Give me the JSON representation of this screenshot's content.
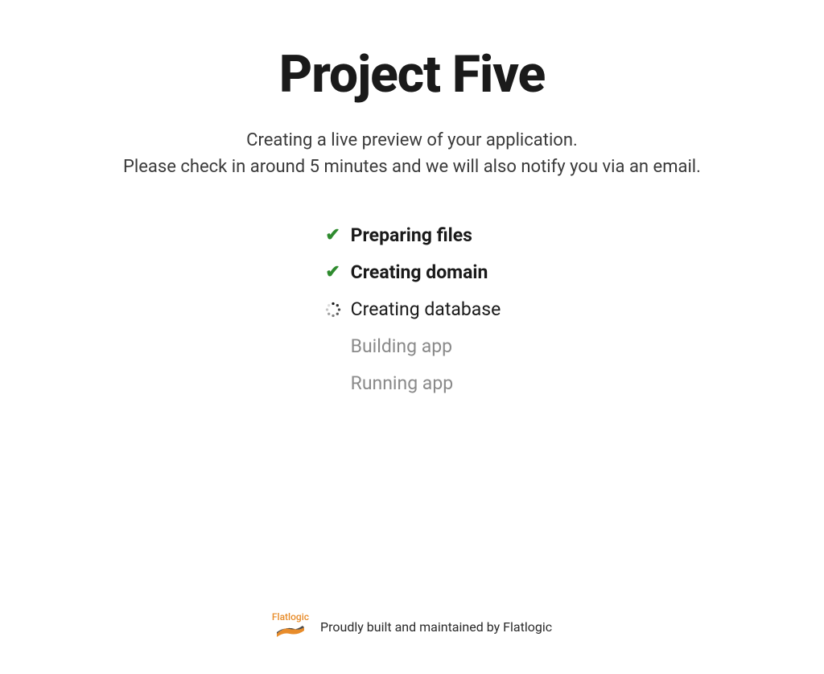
{
  "title": "Project Five",
  "subtitle": {
    "line1": "Creating a live preview of your application.",
    "line2": "Please check in around 5 minutes and we will also notify you via an email."
  },
  "steps": [
    {
      "label": "Preparing files",
      "state": "done"
    },
    {
      "label": "Creating domain",
      "state": "done"
    },
    {
      "label": "Creating database",
      "state": "active"
    },
    {
      "label": "Building app",
      "state": "pending"
    },
    {
      "label": "Running app",
      "state": "pending"
    }
  ],
  "footer": {
    "brand": "Flatlogic",
    "text": "Proudly built and maintained by Flatlogic"
  }
}
